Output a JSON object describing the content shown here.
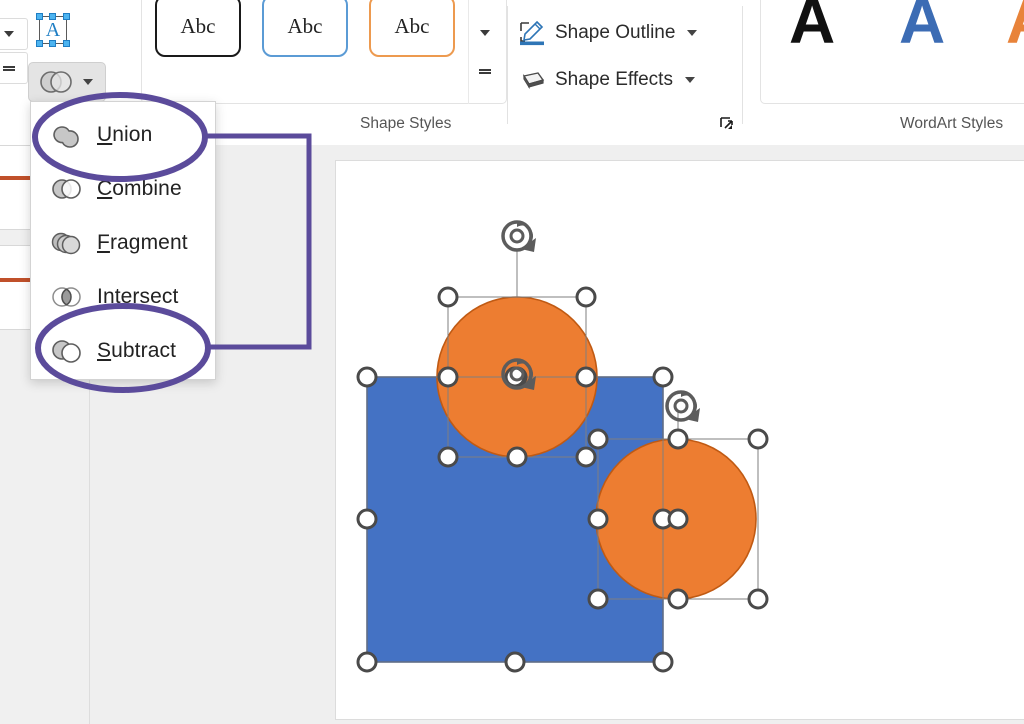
{
  "app": "PowerPoint Shape Format ribbon with Merge Shapes menu open",
  "ribbon": {
    "select_object_icon_letter": "A",
    "merge_shapes_button_label": "",
    "shape_styles": {
      "group_label": "Shape Styles",
      "thumbnails": [
        {
          "label": "Abc",
          "outline": "#1a1a1a"
        },
        {
          "label": "Abc",
          "outline": "#5b9bd5"
        },
        {
          "label": "Abc",
          "outline": "#ed9a4f"
        }
      ],
      "scroll_up": "scroll-up",
      "scroll_down": "scroll-down",
      "more": "more"
    },
    "commands": [
      {
        "label": "Shape Outline",
        "icon": "pen-outline-icon",
        "has_chevron": true
      },
      {
        "label": "Shape Effects",
        "icon": "effects-icon",
        "has_chevron": true
      }
    ],
    "wordart": {
      "group_label": "WordArt Styles",
      "thumbnails": [
        {
          "label": "A",
          "color": "#111111"
        },
        {
          "label": "A",
          "color": "#3c6cb4"
        },
        {
          "label": "A",
          "color": "#e8833a"
        }
      ]
    }
  },
  "merge_menu": {
    "items": [
      {
        "label": "Union",
        "mnemonic": "U",
        "rest": "nion",
        "icon": "merge-union-icon"
      },
      {
        "label": "Combine",
        "mnemonic": "C",
        "rest": "ombine",
        "icon": "merge-combine-icon"
      },
      {
        "label": "Fragment",
        "mnemonic": "F",
        "rest": "ragment",
        "icon": "merge-fragment-icon"
      },
      {
        "label": "Intersect",
        "mnemonic": "I",
        "rest": "ntersect",
        "icon": "merge-intersect-icon"
      },
      {
        "label": "Subtract",
        "mnemonic": "S",
        "rest": "ubtract",
        "icon": "merge-subtract-icon"
      }
    ]
  },
  "annotations": {
    "color": "#5B4B9B",
    "highlighted_items": [
      "Union",
      "Subtract"
    ],
    "shape": "two ellipses joined by a bracket connector"
  },
  "slide": {
    "shapes": [
      {
        "type": "rectangle",
        "fill": "#4472C4",
        "selected": true
      },
      {
        "type": "circle",
        "fill": "#ED7D31",
        "selected": true
      },
      {
        "type": "circle",
        "fill": "#ED7D31",
        "selected": true
      }
    ],
    "handle_fill": "#ffffff",
    "handle_stroke": "#4a4a4a",
    "rotation_handles": 2
  },
  "colors": {
    "shape_blue": "#4472C4",
    "shape_orange": "#ED7D31",
    "annotation_purple": "#5B4B9B",
    "ribbon_bg": "#ffffff",
    "workspace_bg": "#efefef",
    "thumb_line": "#c0502a"
  }
}
